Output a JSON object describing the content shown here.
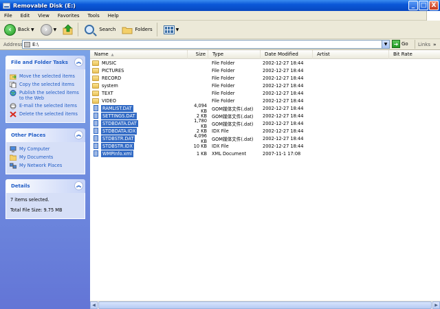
{
  "window": {
    "title": "Removable Disk (E:)",
    "minimize": "_",
    "maximize": "□",
    "close": "X"
  },
  "menu": [
    "File",
    "Edit",
    "View",
    "Favorites",
    "Tools",
    "Help"
  ],
  "toolbar": {
    "back": "Back",
    "search": "Search",
    "folders": "Folders"
  },
  "address": {
    "label": "Address",
    "value": "E:\\",
    "go": "Go",
    "links": "Links"
  },
  "sidebar": {
    "tasks": {
      "title": "File and Folder Tasks",
      "items": [
        "Move the selected items",
        "Copy the selected items",
        "Publish the selected items to the Web",
        "E-mail the selected items",
        "Delete the selected items"
      ]
    },
    "places": {
      "title": "Other Places",
      "items": [
        "My Computer",
        "My Documents",
        "My Network Places"
      ]
    },
    "details": {
      "title": "Details",
      "count": "7 items selected.",
      "size": "Total File Size: 9.75 MB"
    }
  },
  "columns": {
    "name": "Name",
    "size": "Size",
    "type": "Type",
    "date": "Date Modified",
    "artist": "Artist",
    "bitrate": "Bit Rate"
  },
  "files": [
    {
      "name": "MUSIC",
      "size": "",
      "type": "File Folder",
      "date": "2002-12-27 18:44",
      "kind": "folder",
      "selected": false
    },
    {
      "name": "PICTURES",
      "size": "",
      "type": "File Folder",
      "date": "2002-12-27 18:44",
      "kind": "folder",
      "selected": false
    },
    {
      "name": "RECORD",
      "size": "",
      "type": "File Folder",
      "date": "2002-12-27 18:44",
      "kind": "folder",
      "selected": false
    },
    {
      "name": "system",
      "size": "",
      "type": "File Folder",
      "date": "2002-12-27 18:44",
      "kind": "folder",
      "selected": false
    },
    {
      "name": "TEXT",
      "size": "",
      "type": "File Folder",
      "date": "2002-12-27 18:44",
      "kind": "folder",
      "selected": false
    },
    {
      "name": "VIDEO",
      "size": "",
      "type": "File Folder",
      "date": "2002-12-27 18:44",
      "kind": "folder",
      "selected": false
    },
    {
      "name": "RAMLIST.DAT",
      "size": "4,094 KB",
      "type": "GOM媒体文件(.dat)",
      "date": "2002-12-27 18:44",
      "kind": "file",
      "selected": true
    },
    {
      "name": "SETTINGS.DAT",
      "size": "2 KB",
      "type": "GOM媒体文件(.dat)",
      "date": "2002-12-27 18:44",
      "kind": "file",
      "selected": true
    },
    {
      "name": "STDBDATA.DAT",
      "size": "1,780 KB",
      "type": "GOM媒体文件(.dat)",
      "date": "2002-12-27 18:44",
      "kind": "file",
      "selected": true
    },
    {
      "name": "STDBDATA.IDX",
      "size": "2 KB",
      "type": "IDX File",
      "date": "2002-12-27 18:44",
      "kind": "file",
      "selected": true
    },
    {
      "name": "STDBSTR.DAT",
      "size": "4,096 KB",
      "type": "GOM媒体文件(.dat)",
      "date": "2002-12-27 18:44",
      "kind": "file",
      "selected": true
    },
    {
      "name": "STDBSTR.IDX",
      "size": "10 KB",
      "type": "IDX File",
      "date": "2002-12-27 18:44",
      "kind": "file",
      "selected": true
    },
    {
      "name": "WMPInfo.xml",
      "size": "1 KB",
      "type": "XML Document",
      "date": "2007-11-1 17:08",
      "kind": "file",
      "selected": true
    }
  ]
}
